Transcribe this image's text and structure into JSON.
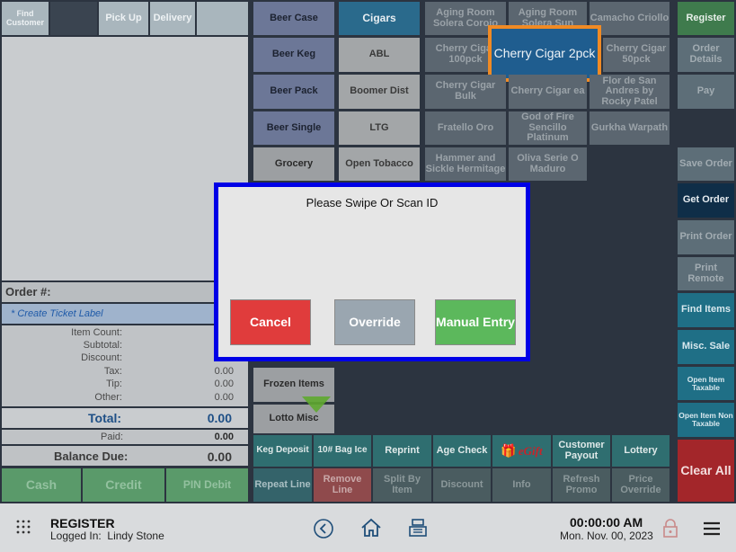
{
  "order_type_tabs": {
    "find_customer": "Find Customer",
    "pick_up": "Pick Up",
    "delivery": "Delivery",
    "fourth": ""
  },
  "order_panel": {
    "order_number_label": "Order #:",
    "ticket_label_link": "* Create Ticket Label",
    "item_count_label": "Item Count:",
    "subtotal_label": "Subtotal:",
    "discount_label": "Discount:",
    "tax_label": "Tax:",
    "tax_value": "0.00",
    "tip_label": "Tip:",
    "tip_value": "0.00",
    "other_label": "Other:",
    "other_value": "0.00",
    "total_label": "Total:",
    "total_value": "0.00",
    "paid_label": "Paid:",
    "paid_value": "0.00",
    "balance_due_label": "Balance Due:",
    "balance_due_value": "0.00"
  },
  "payment_buttons": {
    "cash": "Cash",
    "credit": "Credit",
    "pin_debit": "PIN Debit"
  },
  "categories_col1": [
    "Beer Case",
    "Beer Keg",
    "Beer Pack",
    "Beer Single",
    "Grocery",
    "Frozen Items",
    "Lotto Misc"
  ],
  "categories_col2": [
    "Cigars",
    "ABL",
    "Boomer Dist",
    "LTG",
    "Open Tobacco"
  ],
  "items": {
    "aging_room_solera_corojo": "Aging Room Solera Corojo",
    "aging_room_solera_sun": "Aging Room Solera Sun",
    "camacho_criollo": "Camacho Criollo",
    "cherry_cigar_100pck": "Cherry Cigar 100pck",
    "cherry_cigar_2pck": "Cherry Cigar 2pck",
    "cherry_cigar_50pck": "Cherry Cigar 50pck",
    "cherry_cigar_bulk": "Cherry Cigar Bulk",
    "cherry_cigar_ea": "Cherry Cigar ea",
    "flor_de_san_andres": "Flor de San Andres by Rocky Patel",
    "fratello_oro": "Fratello Oro",
    "god_of_fire": "God of Fire Sencillo Platinum",
    "gurkha_warpath": "Gurkha Warpath",
    "hammer_and_sickle": "Hammer and Sickle Hermitage",
    "oliva_serie_o": "Oliva Serie O Maduro"
  },
  "right_actions": {
    "register": "Register",
    "order_details": "Order Details",
    "pay": "Pay",
    "save_order": "Save Order",
    "get_order": "Get Order",
    "print_order": "Print Order",
    "print_remote": "Print Remote",
    "find_items": "Find Items",
    "misc_sale": "Misc. Sale",
    "open_item_taxable": "Open Item Taxable",
    "open_item_non_taxable": "Open Item Non Taxable",
    "clear_all": "Clear All"
  },
  "quick_row1": {
    "keg_deposit": "Keg Deposit",
    "bag_ice": "10# Bag Ice",
    "reprint": "Reprint",
    "age_check": "Age Check",
    "egift": "eGift",
    "customer_payout": "Customer Payout",
    "lottery": "Lottery"
  },
  "quick_row2": {
    "repeat_line": "Repeat Line",
    "remove_line": "Remove Line",
    "split_by_item": "Split By Item",
    "discount": "Discount",
    "info": "Info",
    "refresh_promo": "Refresh Promo",
    "price_override": "Price Override"
  },
  "modal": {
    "message": "Please Swipe Or Scan ID",
    "cancel": "Cancel",
    "override": "Override",
    "manual_entry": "Manual Entry"
  },
  "footer": {
    "title": "REGISTER",
    "logged_in_label": "Logged In:",
    "user": "Lindy Stone",
    "time": "00:00:00 AM",
    "date": "Mon. Nov. 00, 2023"
  },
  "colors": {
    "highlight_border": "#f08a24",
    "modal_border": "#0000e6",
    "cancel": "#e03c3c",
    "override": "#9aa6b0",
    "manual_entry": "#5cb85c"
  }
}
